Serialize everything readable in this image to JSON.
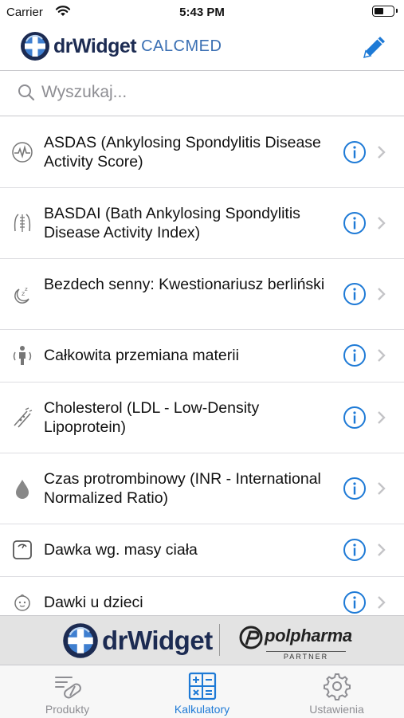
{
  "status_bar": {
    "carrier": "Carrier",
    "time": "5:43 PM"
  },
  "header": {
    "logo_text": "drWidget",
    "logo_sub": "CALCMED",
    "edit_icon": "pencil-icon"
  },
  "search": {
    "placeholder": "Wyszukaj..."
  },
  "calculators": [
    {
      "title": "ASDAS (Ankylosing Spondylitis Disease Activity Score)",
      "icon": "heart-rate-icon"
    },
    {
      "title": "BASDAI (Bath Ankylosing Spondylitis Disease Activity Index)",
      "icon": "spine-body-icon"
    },
    {
      "title": "Bezdech senny: Kwestionariusz berliński",
      "icon": "sleep-icon"
    },
    {
      "title": "Całkowita przemiana materii",
      "icon": "person-metabolism-icon"
    },
    {
      "title": "Cholesterol (LDL - Low-Density Lipoprotein)",
      "icon": "artery-icon"
    },
    {
      "title": "Czas protrombinowy (INR - International Normalized Ratio)",
      "icon": "blood-drop-icon"
    },
    {
      "title": "Dawka wg. masy ciała",
      "icon": "scale-icon"
    },
    {
      "title": "Dawki u dzieci",
      "icon": "baby-icon"
    }
  ],
  "banner": {
    "brand": "drWidget",
    "partner_name": "polpharma",
    "partner_label": "PARTNER"
  },
  "tabs": [
    {
      "label": "Produkty",
      "icon": "pill-list-icon",
      "active": false
    },
    {
      "label": "Kalkulatory",
      "icon": "calculator-icon",
      "active": true
    },
    {
      "label": "Ustawienia",
      "icon": "gear-icon",
      "active": false
    }
  ],
  "colors": {
    "accent": "#1e7ad6",
    "brand_dark": "#1c2b52",
    "separator": "#c8c8cc"
  }
}
